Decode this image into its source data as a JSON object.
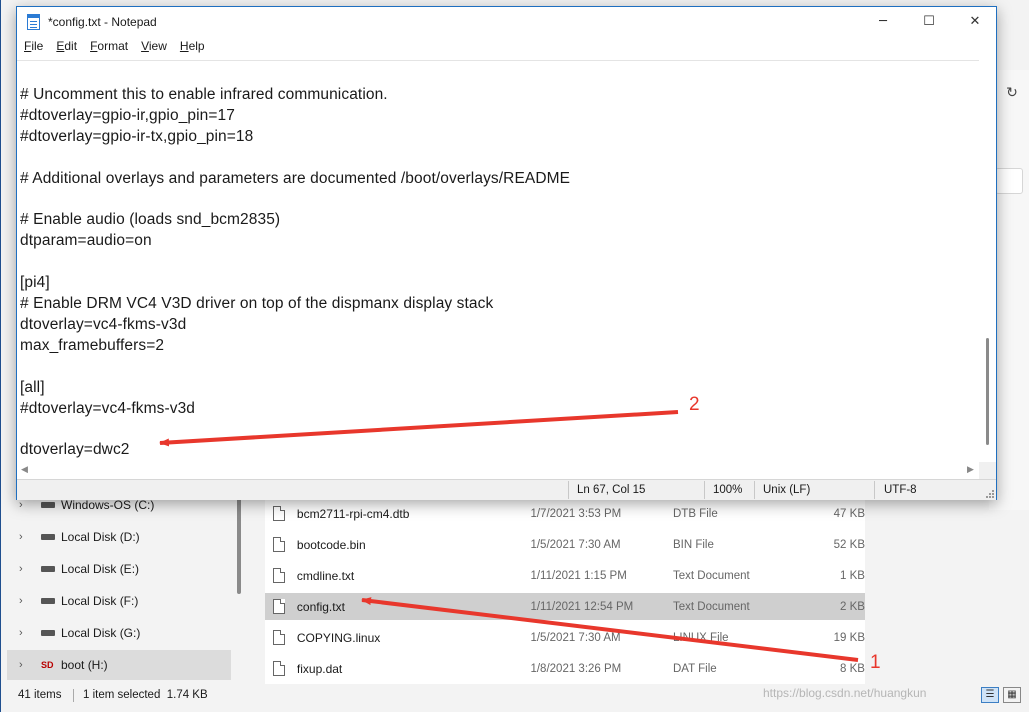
{
  "notepad": {
    "title": "*config.txt - Notepad",
    "menu": [
      {
        "label": "File",
        "mnemonic": "F",
        "rest": "ile"
      },
      {
        "label": "Edit",
        "mnemonic": "E",
        "rest": "dit"
      },
      {
        "label": "Format",
        "mnemonic": "F",
        "rest": "ormat",
        "prefix": ""
      },
      {
        "label": "View",
        "mnemonic": "V",
        "rest": "iew"
      },
      {
        "label": "Help",
        "mnemonic": "H",
        "rest": "elp"
      }
    ],
    "lines": [
      "# Uncomment this to enable infrared communication.",
      "#dtoverlay=gpio-ir,gpio_pin=17",
      "#dtoverlay=gpio-ir-tx,gpio_pin=18",
      "",
      "# Additional overlays and parameters are documented /boot/overlays/README",
      "",
      "# Enable audio (loads snd_bcm2835)",
      "dtparam=audio=on",
      "",
      "[pi4]",
      "# Enable DRM VC4 V3D driver on top of the dispmanx display stack",
      "dtoverlay=vc4-fkms-v3d",
      "max_framebuffers=2",
      "",
      "[all]",
      "#dtoverlay=vc4-fkms-v3d",
      "",
      "dtoverlay=dwc2"
    ],
    "status": {
      "position": "Ln 67, Col 15",
      "zoom": "100%",
      "line_ending": "Unix (LF)",
      "encoding": "UTF-8"
    }
  },
  "explorer": {
    "nav_items": [
      {
        "label": "Windows-OS (C:)",
        "icon": "drive-icon",
        "selected": false
      },
      {
        "label": "Local Disk (D:)",
        "icon": "drive-icon",
        "selected": false
      },
      {
        "label": "Local Disk (E:)",
        "icon": "drive-icon",
        "selected": false
      },
      {
        "label": "Local Disk (F:)",
        "icon": "drive-icon",
        "selected": false
      },
      {
        "label": "Local Disk (G:)",
        "icon": "drive-icon",
        "selected": false
      },
      {
        "label": "boot (H:)",
        "icon": "sd-card-icon",
        "selected": true
      }
    ],
    "files": [
      {
        "name": "bcm2711-rpi-cm4.dtb",
        "date": "1/7/2021 3:53 PM",
        "type": "DTB File",
        "size": "47 KB",
        "selected": false
      },
      {
        "name": "bootcode.bin",
        "date": "1/5/2021 7:30 AM",
        "type": "BIN File",
        "size": "52 KB",
        "selected": false
      },
      {
        "name": "cmdline.txt",
        "date": "1/11/2021 1:15 PM",
        "type": "Text Document",
        "size": "1 KB",
        "selected": false
      },
      {
        "name": "config.txt",
        "date": "1/11/2021 12:54 PM",
        "type": "Text Document",
        "size": "2 KB",
        "selected": true
      },
      {
        "name": "COPYING.linux",
        "date": "1/5/2021 7:30 AM",
        "type": "LINUX File",
        "size": "19 KB",
        "selected": false
      },
      {
        "name": "fixup.dat",
        "date": "1/8/2021 3:26 PM",
        "type": "DAT File",
        "size": "8 KB",
        "selected": false
      }
    ],
    "status": {
      "items": "41 items",
      "selection": "1 item selected  1.74 KB"
    }
  },
  "annotations": {
    "label_1": "1",
    "label_2": "2",
    "color": "#e8372c"
  },
  "watermark": "https://blog.csdn.net/huangkun"
}
